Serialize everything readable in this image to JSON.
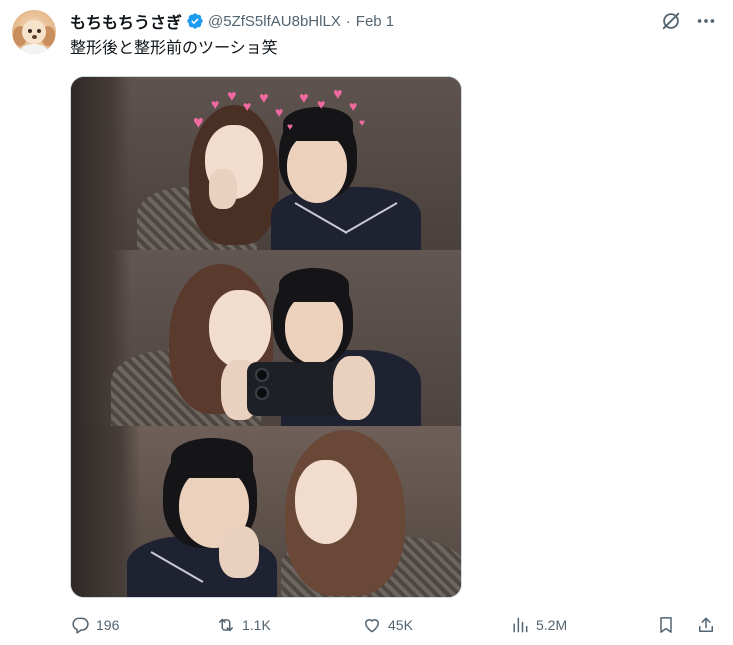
{
  "author": {
    "display_name": "もちもちうさぎ",
    "handle": "@5ZfS5lfAU8bHlLX",
    "separator": "·",
    "date": "Feb 1",
    "verified": true
  },
  "tweet": {
    "text": "整形後と整形前のツーショ笑"
  },
  "actions": {
    "replies": "196",
    "reposts": "1.1K",
    "likes": "45K",
    "views": "5.2M"
  },
  "colors": {
    "verified_blue": "#1d9bf0",
    "text_primary": "#0f1419",
    "text_secondary": "#536471"
  },
  "icons": {
    "header_right": [
      "grok-icon",
      "more-icon"
    ],
    "action_bar": [
      "reply-icon",
      "repost-icon",
      "like-icon",
      "views-icon",
      "bookmark-icon",
      "share-icon"
    ]
  }
}
